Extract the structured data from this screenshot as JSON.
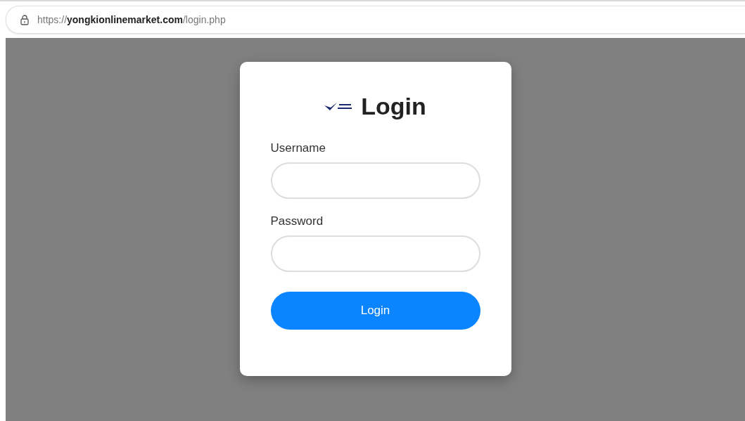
{
  "address_bar": {
    "url": "https://**yongkionlinemarket.com**/login.php"
  },
  "login_card": {
    "title": "Login",
    "fields": [
      {
        "label": "Username"
      },
      {
        "label": "Password"
      }
    ],
    "submit_button": "Login"
  }
}
